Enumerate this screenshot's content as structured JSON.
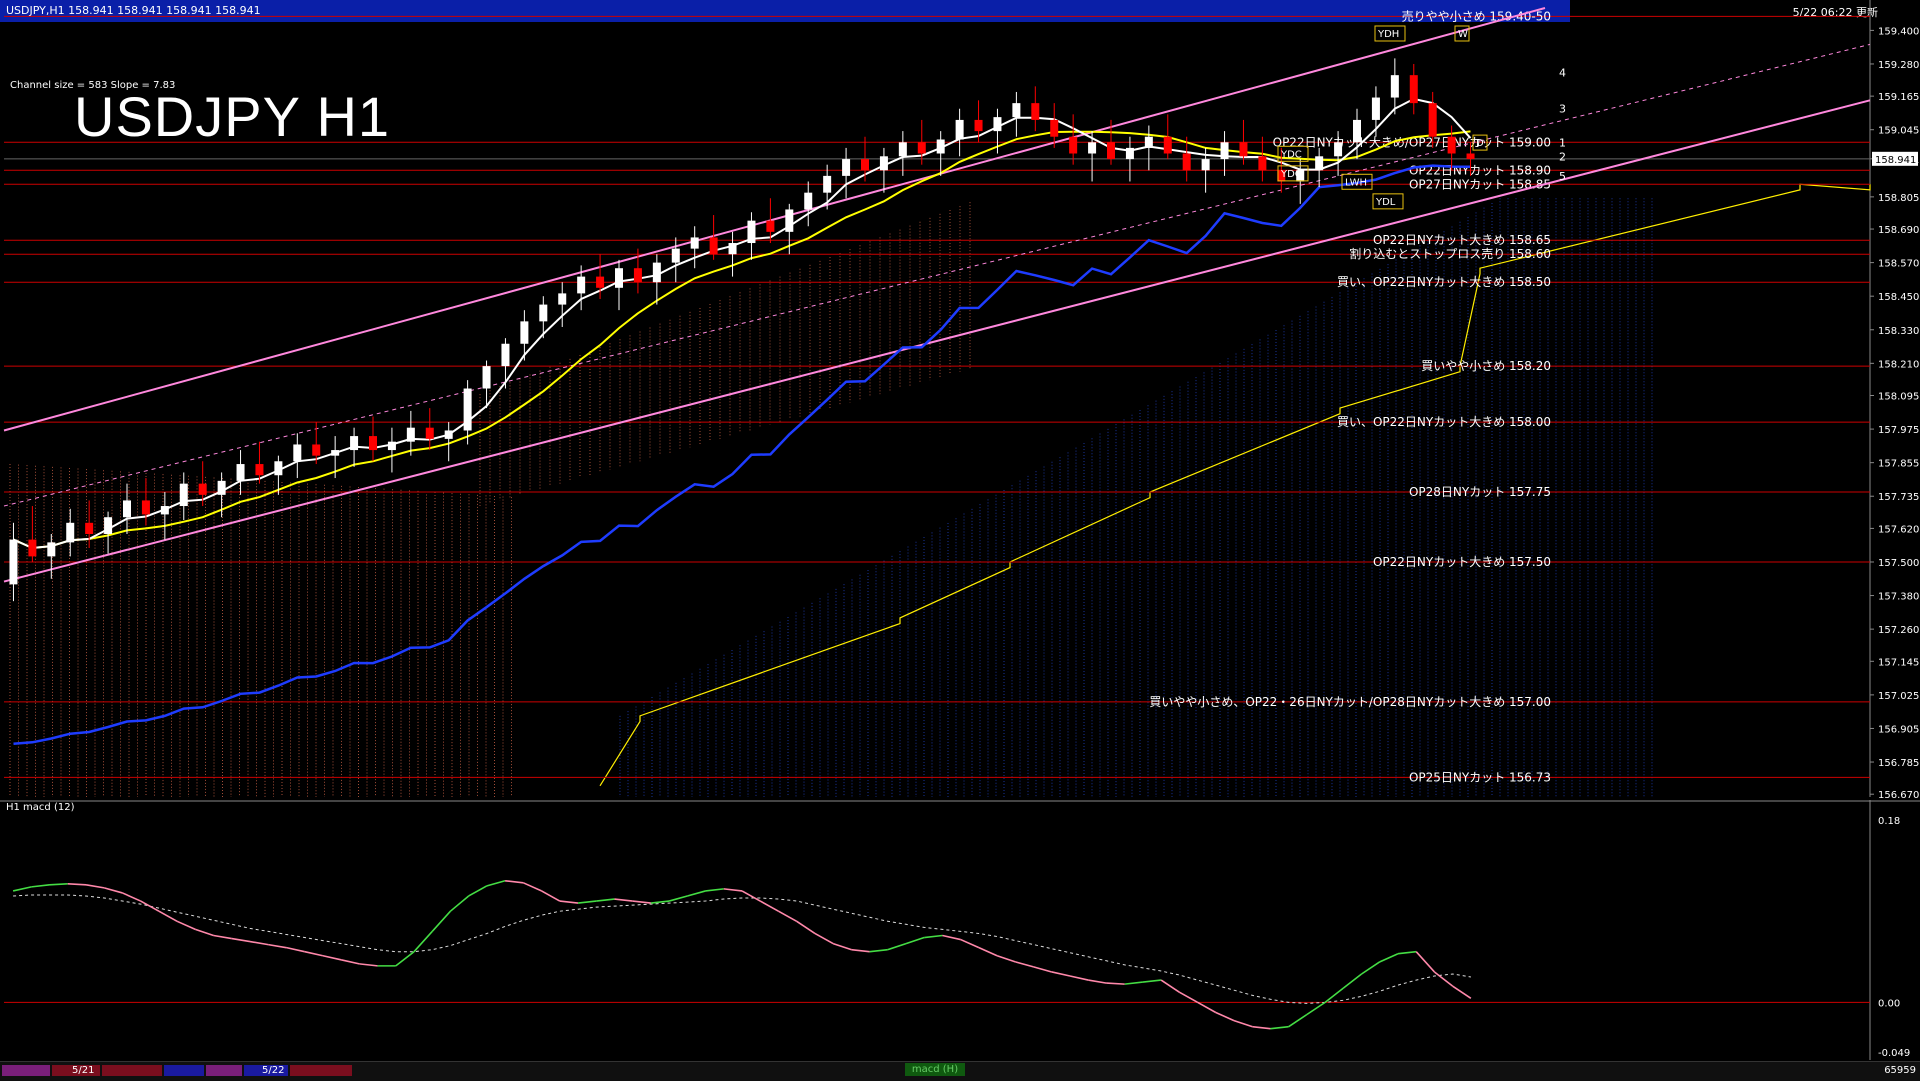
{
  "header": {
    "symbol_info": "USDJPY,H1  158.941 158.941 158.941 158.941",
    "stamp": "5/22 06:22 更新"
  },
  "title": "USDJPY H1",
  "channel_info": "Channel size = 583 Slope = 7.83",
  "indicator_title": "H1  macd (12)",
  "colors": {
    "background": "#000000",
    "header_bar": "#0a1fa8",
    "level_line": "#cc0000",
    "bull_candle": "#ffffff",
    "bear_candle": "#ff0000",
    "ma_fast": "#ffffff",
    "ma_mid": "#ffff00",
    "ma_slow": "#1e3cff",
    "channel": "#ff88dd",
    "cloud_up": "#e87050",
    "cloud_down": "#2040c0",
    "macd_up": "#44dd44",
    "macd_down": "#ff88aa"
  },
  "chart_data": {
    "type": "candlestick",
    "price_axis": {
      "ticks": [
        "159.400",
        "159.280",
        "159.165",
        "159.045",
        "158.941",
        "158.805",
        "158.690",
        "158.570",
        "158.450",
        "158.330",
        "158.210",
        "158.095",
        "157.975",
        "157.855",
        "157.735",
        "157.620",
        "157.500",
        "157.380",
        "157.260",
        "157.145",
        "157.025",
        "156.905",
        "156.785",
        "156.670"
      ],
      "current_price": "158.941",
      "ylim": [
        156.66,
        159.43
      ]
    },
    "levels": [
      {
        "price": 159.45,
        "label": "売りやや小さめ 159.40-50"
      },
      {
        "price": 159.0,
        "label": "OP22日NYカット大きめ/OP27日NYカット 159.00"
      },
      {
        "price": 158.9,
        "label": "OP22日NYカット 158.90"
      },
      {
        "price": 158.85,
        "label": "OP27日NYカット 158.85"
      },
      {
        "price": 158.65,
        "label": "OP22日NYカット大きめ 158.65"
      },
      {
        "price": 158.6,
        "label": "割り込むとストップロス売り 158.60"
      },
      {
        "price": 158.5,
        "label": "買い、OP22日NYカット大きめ 158.50"
      },
      {
        "price": 158.2,
        "label": "買いやや小さめ 158.20"
      },
      {
        "price": 158.0,
        "label": "買い、OP22日NYカット大きめ 158.00"
      },
      {
        "price": 157.75,
        "label": "OP28日NYカット 157.75"
      },
      {
        "price": 157.5,
        "label": "OP22日NYカット大きめ 157.50"
      },
      {
        "price": 157.0,
        "label": "買いやや小さめ、OP22・26日NYカット/OP28日NYカット大きめ 157.00"
      },
      {
        "price": 156.73,
        "label": "OP25日NYカット 156.73"
      }
    ],
    "box_labels": [
      "YDH",
      "YDC",
      "YDO",
      "LWH",
      "YDL",
      "W",
      "D"
    ],
    "level_numbers": [
      "4",
      "3",
      "1",
      "2",
      "5"
    ],
    "candles": [
      [
        157.42,
        157.64,
        157.36,
        157.58
      ],
      [
        157.58,
        157.7,
        157.5,
        157.52
      ],
      [
        157.52,
        157.6,
        157.44,
        157.57
      ],
      [
        157.57,
        157.69,
        157.52,
        157.64
      ],
      [
        157.64,
        157.72,
        157.55,
        157.6
      ],
      [
        157.6,
        157.68,
        157.53,
        157.66
      ],
      [
        157.66,
        157.78,
        157.6,
        157.72
      ],
      [
        157.72,
        157.8,
        157.63,
        157.67
      ],
      [
        157.67,
        157.75,
        157.58,
        157.7
      ],
      [
        157.7,
        157.82,
        157.65,
        157.78
      ],
      [
        157.78,
        157.86,
        157.7,
        157.74
      ],
      [
        157.74,
        157.82,
        157.66,
        157.79
      ],
      [
        157.79,
        157.9,
        157.74,
        157.85
      ],
      [
        157.85,
        157.93,
        157.78,
        157.81
      ],
      [
        157.81,
        157.88,
        157.74,
        157.86
      ],
      [
        157.86,
        157.96,
        157.8,
        157.92
      ],
      [
        157.92,
        158.0,
        157.85,
        157.88
      ],
      [
        157.88,
        157.95,
        157.8,
        157.9
      ],
      [
        157.9,
        157.98,
        157.84,
        157.95
      ],
      [
        157.95,
        158.02,
        157.86,
        157.9
      ],
      [
        157.9,
        157.98,
        157.82,
        157.93
      ],
      [
        157.93,
        158.04,
        157.88,
        157.98
      ],
      [
        157.98,
        158.05,
        157.9,
        157.94
      ],
      [
        157.94,
        158.0,
        157.86,
        157.97
      ],
      [
        157.97,
        158.15,
        157.92,
        158.12
      ],
      [
        158.12,
        158.22,
        158.05,
        158.2
      ],
      [
        158.2,
        158.3,
        158.12,
        158.28
      ],
      [
        158.28,
        158.4,
        158.22,
        158.36
      ],
      [
        158.36,
        158.45,
        158.3,
        158.42
      ],
      [
        158.42,
        158.5,
        158.34,
        158.46
      ],
      [
        158.46,
        158.56,
        158.4,
        158.52
      ],
      [
        158.52,
        158.6,
        158.44,
        158.48
      ],
      [
        158.48,
        158.58,
        158.4,
        158.55
      ],
      [
        158.55,
        158.62,
        158.46,
        158.5
      ],
      [
        158.5,
        158.6,
        158.42,
        158.57
      ],
      [
        158.57,
        158.66,
        158.5,
        158.62
      ],
      [
        158.62,
        158.7,
        158.55,
        158.66
      ],
      [
        158.66,
        158.74,
        158.58,
        158.6
      ],
      [
        158.6,
        158.68,
        158.52,
        158.64
      ],
      [
        158.64,
        158.75,
        158.58,
        158.72
      ],
      [
        158.72,
        158.8,
        158.64,
        158.68
      ],
      [
        158.68,
        158.78,
        158.6,
        158.76
      ],
      [
        158.76,
        158.86,
        158.7,
        158.82
      ],
      [
        158.82,
        158.92,
        158.76,
        158.88
      ],
      [
        158.88,
        158.98,
        158.8,
        158.94
      ],
      [
        158.94,
        159.02,
        158.86,
        158.9
      ],
      [
        158.9,
        158.98,
        158.82,
        158.95
      ],
      [
        158.95,
        159.04,
        158.88,
        159.0
      ],
      [
        159.0,
        159.08,
        158.92,
        158.96
      ],
      [
        158.96,
        159.04,
        158.88,
        159.01
      ],
      [
        159.01,
        159.12,
        158.95,
        159.08
      ],
      [
        159.08,
        159.15,
        159.0,
        159.04
      ],
      [
        159.04,
        159.12,
        158.96,
        159.09
      ],
      [
        159.09,
        159.18,
        159.02,
        159.14
      ],
      [
        159.14,
        159.2,
        159.04,
        159.08
      ],
      [
        159.08,
        159.14,
        158.98,
        159.02
      ],
      [
        159.02,
        159.1,
        158.92,
        158.96
      ],
      [
        158.96,
        159.04,
        158.86,
        159.0
      ],
      [
        159.0,
        159.08,
        158.92,
        158.94
      ],
      [
        158.94,
        159.02,
        158.86,
        158.98
      ],
      [
        158.98,
        159.06,
        158.9,
        159.02
      ],
      [
        159.02,
        159.1,
        158.94,
        158.96
      ],
      [
        158.96,
        159.02,
        158.86,
        158.9
      ],
      [
        158.9,
        158.98,
        158.82,
        158.94
      ],
      [
        158.94,
        159.04,
        158.88,
        159.0
      ],
      [
        159.0,
        159.08,
        158.92,
        158.95
      ],
      [
        158.95,
        159.02,
        158.86,
        158.9
      ],
      [
        158.9,
        158.98,
        158.82,
        158.86
      ],
      [
        158.86,
        158.94,
        158.78,
        158.9
      ],
      [
        158.9,
        158.98,
        158.84,
        158.95
      ],
      [
        158.95,
        159.04,
        158.88,
        159.0
      ],
      [
        159.0,
        159.12,
        158.94,
        159.08
      ],
      [
        159.08,
        159.2,
        159.02,
        159.16
      ],
      [
        159.16,
        159.3,
        159.1,
        159.24
      ],
      [
        159.24,
        159.28,
        159.1,
        159.14
      ],
      [
        159.14,
        159.18,
        158.98,
        159.02
      ],
      [
        159.02,
        159.06,
        158.9,
        158.96
      ],
      [
        158.96,
        159.0,
        158.88,
        158.94
      ]
    ],
    "macd": {
      "ylim": [
        -0.049,
        0.18
      ],
      "ticks": [
        "0.18",
        "0.00",
        "-0.049"
      ],
      "main": [
        0.11,
        0.114,
        0.116,
        0.117,
        0.116,
        0.113,
        0.108,
        0.1,
        0.09,
        0.08,
        0.072,
        0.066,
        0.063,
        0.06,
        0.057,
        0.054,
        0.05,
        0.046,
        0.042,
        0.038,
        0.036,
        0.036,
        0.05,
        0.07,
        0.09,
        0.105,
        0.115,
        0.12,
        0.118,
        0.11,
        0.1,
        0.098,
        0.1,
        0.102,
        0.1,
        0.098,
        0.1,
        0.105,
        0.11,
        0.112,
        0.11,
        0.1,
        0.09,
        0.08,
        0.068,
        0.058,
        0.052,
        0.05,
        0.052,
        0.058,
        0.064,
        0.066,
        0.062,
        0.054,
        0.046,
        0.04,
        0.035,
        0.03,
        0.026,
        0.022,
        0.019,
        0.018,
        0.02,
        0.022,
        0.01,
        0.0,
        -0.01,
        -0.018,
        -0.024,
        -0.026,
        -0.024,
        -0.012,
        0.0,
        0.014,
        0.028,
        0.04,
        0.048,
        0.05,
        0.03,
        0.016,
        0.004
      ],
      "signal": [
        0.105,
        0.106,
        0.106,
        0.106,
        0.105,
        0.103,
        0.1,
        0.097,
        0.093,
        0.089,
        0.085,
        0.081,
        0.077,
        0.073,
        0.07,
        0.067,
        0.064,
        0.061,
        0.058,
        0.055,
        0.052,
        0.05,
        0.05,
        0.052,
        0.056,
        0.062,
        0.068,
        0.075,
        0.081,
        0.086,
        0.09,
        0.092,
        0.094,
        0.095,
        0.096,
        0.097,
        0.098,
        0.099,
        0.1,
        0.102,
        0.103,
        0.103,
        0.102,
        0.1,
        0.096,
        0.092,
        0.088,
        0.084,
        0.08,
        0.077,
        0.074,
        0.072,
        0.07,
        0.068,
        0.065,
        0.061,
        0.057,
        0.053,
        0.049,
        0.045,
        0.041,
        0.037,
        0.034,
        0.031,
        0.027,
        0.022,
        0.017,
        0.012,
        0.007,
        0.003,
        0.0,
        -0.001,
        0.0,
        0.002,
        0.006,
        0.011,
        0.017,
        0.022,
        0.026,
        0.028,
        0.025
      ]
    },
    "dates": [
      "5/21",
      "5/22"
    ],
    "bottom_right": "65959",
    "macd_tab": "macd (H)"
  }
}
